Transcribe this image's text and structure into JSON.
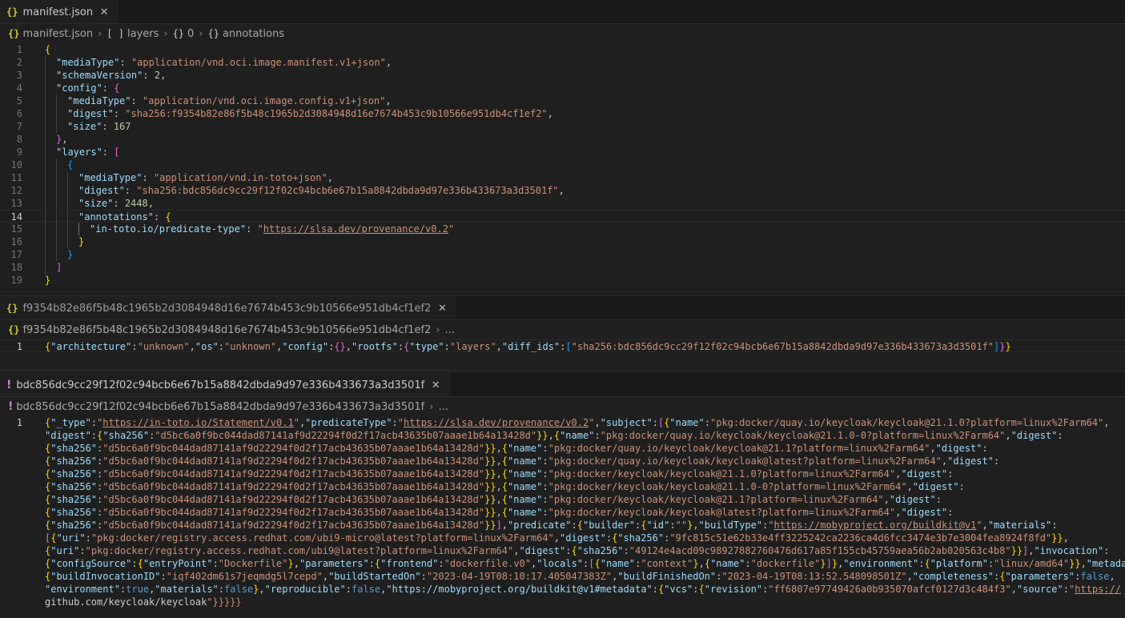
{
  "pane1": {
    "tab_label": "manifest.json",
    "tab_icon": "{}",
    "breadcrumb": [
      {
        "icon": "{}",
        "label": "manifest.json"
      },
      {
        "icon": "[ ]",
        "label": "layers"
      },
      {
        "icon": "{}",
        "label": "0"
      },
      {
        "icon": "{}",
        "label": "annotations"
      }
    ],
    "line_numbers": [
      "1",
      "2",
      "3",
      "4",
      "5",
      "6",
      "7",
      "8",
      "9",
      "10",
      "11",
      "12",
      "13",
      "14",
      "15",
      "16",
      "17",
      "18",
      "19"
    ],
    "active_line": "14",
    "code": {
      "mediaType_key": "\"mediaType\"",
      "mediaType_val": "\"application/vnd.oci.image.manifest.v1+json\"",
      "schemaVersion_key": "\"schemaVersion\"",
      "schemaVersion_val": "2",
      "config_key": "\"config\"",
      "cfg_mediaType_val": "\"application/vnd.oci.image.config.v1+json\"",
      "digest_key": "\"digest\"",
      "cfg_digest_val": "\"sha256:f9354b82e86f5b48c1965b2d3084948d16e7674b453c9b10566e951db4cf1ef2\"",
      "size_key": "\"size\"",
      "cfg_size_val": "167",
      "layers_key": "\"layers\"",
      "layer_mediaType_val": "\"application/vnd.in-toto+json\"",
      "layer_digest_val": "\"sha256:bdc856dc9cc29f12f02c94bcb6e67b15a8842dbda9d97e336b433673a3d3501f\"",
      "layer_size_val": "2448",
      "annotations_key": "\"annotations\"",
      "predicate_key": "\"in-toto.io/predicate-type\"",
      "predicate_val_url": "https://slsa.dev/provenance/v0.2"
    }
  },
  "pane2": {
    "tab_label": "f9354b82e86f5b48c1965b2d3084948d16e7674b453c9b10566e951db4cf1ef2",
    "tab_icon": "{}",
    "breadcrumb_label": "f9354b82e86f5b48c1965b2d3084948d16e7674b453c9b10566e951db4cf1ef2",
    "breadcrumb_more": "...",
    "line_number": "1",
    "code": {
      "architecture_key": "\"architecture\"",
      "architecture_val": "\"unknown\"",
      "os_key": "\"os\"",
      "os_val": "\"unknown\"",
      "config_key": "\"config\"",
      "rootfs_key": "\"rootfs\"",
      "type_key": "\"type\"",
      "type_val": "\"layers\"",
      "diff_ids_key": "\"diff_ids\"",
      "diff_id_val": "\"sha256:bdc856dc9cc29f12f02c94bcb6e67b15a8842dbda9d97e336b433673a3d3501f\""
    }
  },
  "pane3": {
    "tab_label": "bdc856dc9cc29f12f02c94bcb6e67b15a8842dbda9d97e336b433673a3d3501f",
    "tab_icon": "!",
    "breadcrumb_label": "bdc856dc9cc29f12f02c94bcb6e67b15a8842dbda9d97e336b433673a3d3501f",
    "breadcrumb_more": "...",
    "line_number": "1",
    "wrapped_lines": [
      "{\"_type\":\"https://in-toto.io/Statement/v0.1\",\"predicateType\":\"https://slsa.dev/provenance/v0.2\",\"subject\":[{\"name\":\"pkg:docker/quay.io/keycloak/keycloak@21.1.0?platform=linux%2Farm64\",",
      "\"digest\":{\"sha256\":\"d5bc6a0f9bc044dad87141af9d22294f0d2f17acb43635b07aaae1b64a13428d\"}},{\"name\":\"pkg:docker/quay.io/keycloak/keycloak@21.1.0-0?platform=linux%2Farm64\",\"digest\":",
      "{\"sha256\":\"d5bc6a0f9bc044dad87141af9d22294f0d2f17acb43635b07aaae1b64a13428d\"}},{\"name\":\"pkg:docker/quay.io/keycloak/keycloak@21.1?platform=linux%2Farm64\",\"digest\":",
      "{\"sha256\":\"d5bc6a0f9bc044dad87141af9d22294f0d2f17acb43635b07aaae1b64a13428d\"}},{\"name\":\"pkg:docker/quay.io/keycloak/keycloak@latest?platform=linux%2Farm64\",\"digest\":",
      "{\"sha256\":\"d5bc6a0f9bc044dad87141af9d22294f0d2f17acb43635b07aaae1b64a13428d\"}},{\"name\":\"pkg:docker/keycloak/keycloak@21.1.0?platform=linux%2Farm64\",\"digest\":",
      "{\"sha256\":\"d5bc6a0f9bc044dad87141af9d22294f0d2f17acb43635b07aaae1b64a13428d\"}},{\"name\":\"pkg:docker/keycloak/keycloak@21.1.0-0?platform=linux%2Farm64\",\"digest\":",
      "{\"sha256\":\"d5bc6a0f9bc044dad87141af9d22294f0d2f17acb43635b07aaae1b64a13428d\"}},{\"name\":\"pkg:docker/keycloak/keycloak@21.1?platform=linux%2Farm64\",\"digest\":",
      "{\"sha256\":\"d5bc6a0f9bc044dad87141af9d22294f0d2f17acb43635b07aaae1b64a13428d\"}},{\"name\":\"pkg:docker/keycloak/keycloak@latest?platform=linux%2Farm64\",\"digest\":",
      "{\"sha256\":\"d5bc6a0f9bc044dad87141af9d22294f0d2f17acb43635b07aaae1b64a13428d\"}}],\"predicate\":{\"builder\":{\"id\":\"\"},\"buildType\":\"https://mobyproject.org/buildkit@v1\",\"materials\":",
      "[{\"uri\":\"pkg:docker/registry.access.redhat.com/ubi9-micro@latest?platform=linux%2Farm64\",\"digest\":{\"sha256\":\"9fc815c51e62b33e4ff3225242ca2236ca4d6fcc3474e3b7e3004fea8924f8fd\"}},",
      "{\"uri\":\"pkg:docker/registry.access.redhat.com/ubi9@latest?platform=linux%2Farm64\",\"digest\":{\"sha256\":\"49124e4acd09c98927882760476d617a85f155cb45759aea56b2ab020563c4b8\"}}],\"invocation\":",
      "{\"configSource\":{\"entryPoint\":\"Dockerfile\"},\"parameters\":{\"frontend\":\"dockerfile.v0\",\"locals\":[{\"name\":\"context\"},{\"name\":\"dockerfile\"}]},\"environment\":{\"platform\":\"linux/amd64\"}},\"metadata\":",
      "{\"buildInvocationID\":\"iqf402dm61s7jeqmdg5l7cepd\",\"buildStartedOn\":\"2023-04-19T08:10:17.405047383Z\",\"buildFinishedOn\":\"2023-04-19T08:13:52.548098501Z\",\"completeness\":{\"parameters\":false,",
      "\"environment\":true,\"materials\":false},\"reproducible\":false,\"https://mobyproject.org/buildkit@v1#metadata\":{\"vcs\":{\"revision\":\"ff6807e97749426a0b935070afcf0127d3c484f3\",\"source\":\"https://",
      "github.com/keycloak/keycloak\"}}}}}"
    ]
  },
  "close_glyph": "✕"
}
